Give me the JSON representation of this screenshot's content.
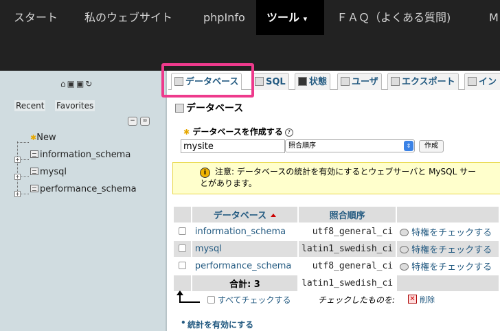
{
  "topnav": {
    "items": [
      "スタート",
      "私のウェブサイト",
      "phpInfo",
      "ツール",
      "ＦＡＱ（よくある質問)",
      "M"
    ],
    "tools_caret": "▾"
  },
  "sidebar": {
    "icons": "⌂▣▣↻",
    "recent": "Recent",
    "favorites": "Favorites",
    "collapse": "−",
    "link": "∞",
    "tree": [
      "New",
      "information_schema",
      "mysql",
      "performance_schema"
    ],
    "plus": "+"
  },
  "tabs": [
    {
      "label": "データベース",
      "icon": "db"
    },
    {
      "label": "SQL",
      "icon": "sql"
    },
    {
      "label": "状態",
      "icon": "status"
    },
    {
      "label": "ユーザ",
      "icon": "users"
    },
    {
      "label": "エクスポート",
      "icon": "export"
    },
    {
      "label": "イン",
      "icon": "import"
    }
  ],
  "main": {
    "heading": "データベース",
    "create_label": "データベースを作成する",
    "help": "?",
    "db_name_value": "mysite",
    "collation_label": "照合順序",
    "create_button": "作成",
    "notice_icon": "i",
    "notice_line1": "注意: データベースの統計を有効にするとウェブサーバと MySQL サー",
    "notice_line2": "とがあります。"
  },
  "table": {
    "headers": [
      "データベース",
      "照合順序"
    ],
    "rows": [
      {
        "name": "information_schema",
        "collation": "utf8_general_ci",
        "action": "特権をチェックする"
      },
      {
        "name": "mysql",
        "collation": "latin1_swedish_ci",
        "action": "特権をチェックする"
      },
      {
        "name": "performance_schema",
        "collation": "utf8_general_ci",
        "action": "特権をチェックする"
      }
    ],
    "total_label": "合計: 3",
    "total_collation": "latin1_swedish_ci"
  },
  "bottom": {
    "check_all": "すべてチェックする",
    "with_checked": "チェックしたものを:",
    "delete": "削除",
    "enable_stats": "統計を有効にする"
  },
  "colors": {
    "accent": "#ee3a8c",
    "link": "#235a81",
    "nav_bg": "#222222",
    "sidebar_bg": "#d0dce0",
    "notice_bg": "#ffffcc"
  }
}
